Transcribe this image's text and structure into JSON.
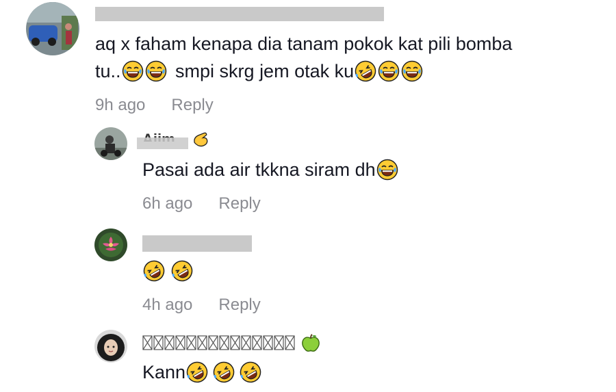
{
  "comments": [
    {
      "username": "",
      "text": "aq x faham kenapa dia tanam pokok kat pili bomba",
      "text_line2": "tu..",
      "text_line2b": "smpi skrg jem otak ku",
      "time": "9h ago",
      "reply_label": "Reply"
    },
    {
      "username": "Ajim_",
      "text": "Pasai ada air tkkna siram dh",
      "time": "6h ago",
      "reply_label": "Reply"
    },
    {
      "username": "",
      "text": "",
      "time": "4h ago",
      "reply_label": "Reply"
    },
    {
      "username": "",
      "text": "Kann",
      "time": "",
      "reply_label": ""
    }
  ],
  "icons": {
    "joy": "face-with-tears-of-joy-icon",
    "rofl": "rolling-on-floor-laughing-icon",
    "pinch": "pinching-hand-icon",
    "apple": "green-apple-icon"
  },
  "colors": {
    "text": "#161823",
    "meta": "#8a8b91",
    "emoji_yellow": "#ffcc33",
    "redaction": "#c9c9c9"
  }
}
